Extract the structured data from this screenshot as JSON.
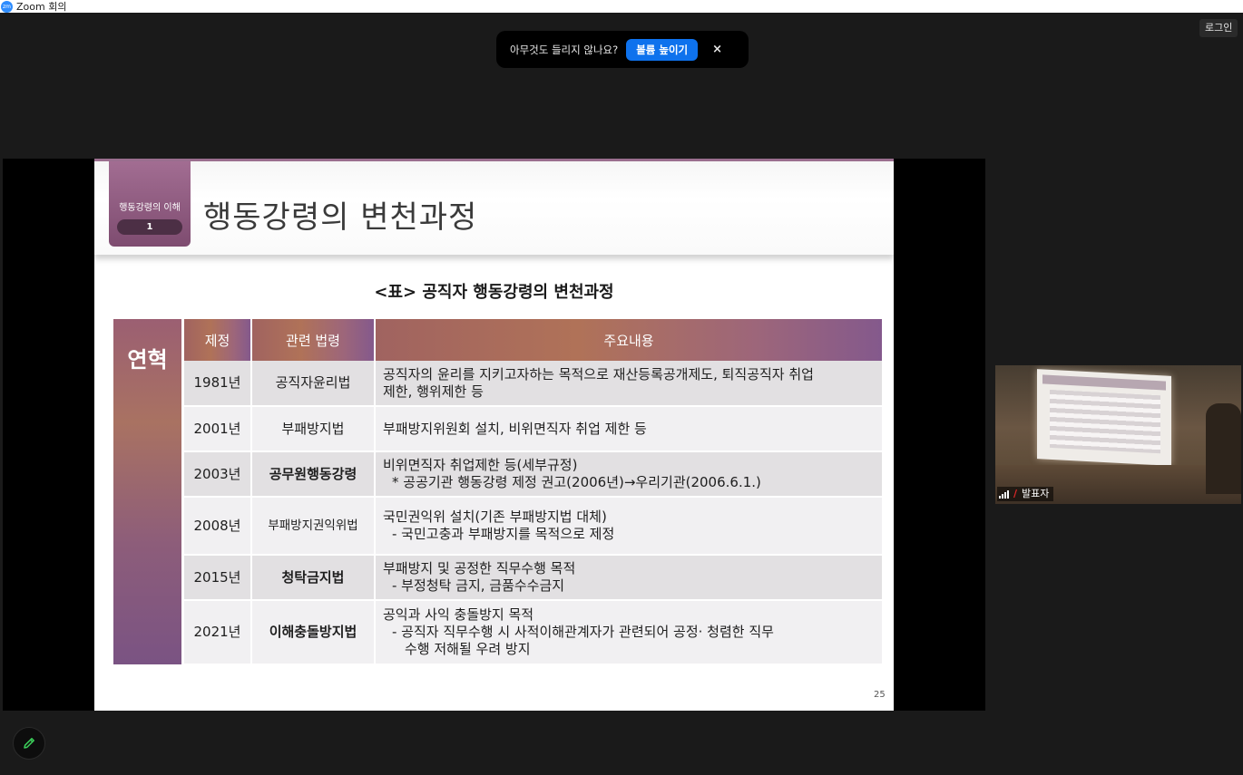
{
  "window": {
    "app_icon": "zm",
    "title": "Zoom 회의"
  },
  "toolbar": {
    "login_label": "로그인"
  },
  "audio_banner": {
    "message": "아무것도 들리지 않나요?",
    "action_label": "볼륨 높이기",
    "close_label": "×"
  },
  "slide": {
    "section_label": "행동강령의 이해",
    "section_number": "1",
    "title": "행동강령의 변천과정",
    "caption": "<표> 공직자 행동강령의 변천과정",
    "side_label": "연혁",
    "page_number": "25",
    "table": {
      "headers": [
        "제정",
        "관련 법령",
        "주요내용"
      ],
      "rows": [
        {
          "year": "1981년",
          "law": "공직자윤리법",
          "lines": [
            "공직자의 윤리를 지키고자하는 목적으로 재산등록공개제도, 퇴직공직자 취업",
            "제한, 행위제한 등"
          ]
        },
        {
          "year": "2001년",
          "law": "부패방지법",
          "lines": [
            "부패방지위원회 설치, 비위면직자 취업 제한 등"
          ]
        },
        {
          "year": "2003년",
          "law": "공무원행동강령",
          "lines": [
            "비위면직자 취업제한 등(세부규정)",
            "* 공공기관 행동강령 제정 권고(2006년)→우리기관(2006.6.1.)"
          ]
        },
        {
          "year": "2008년",
          "law": "부패방지권익위법",
          "lines": [
            "국민권익위 설치(기존 부패방지법 대체)",
            "- 국민고충과 부패방지를 목적으로 제정"
          ]
        },
        {
          "year": "2015년",
          "law": "청탁금지법",
          "lines": [
            "부패방지 및 공정한 직무수행 목적",
            "- 부정청탁 금지, 금품수수금지"
          ]
        },
        {
          "year": "2021년",
          "law": "이해충돌방지법",
          "lines": [
            "공익과 사익 충돌방지 목적",
            "- 공직자 직무수행 시 사적이해관계자가 관련되어  공정· 청렴한 직무",
            "수행 저해될 우려 방지"
          ]
        }
      ]
    }
  },
  "participant": {
    "name": "발표자",
    "icons": [
      "signal-icon",
      "mic-muted-icon"
    ]
  },
  "annotate": {
    "icon": "pencil-icon"
  },
  "colors": {
    "accent_blue": "#0e72ed",
    "slide_purple": "#7e4c70"
  }
}
